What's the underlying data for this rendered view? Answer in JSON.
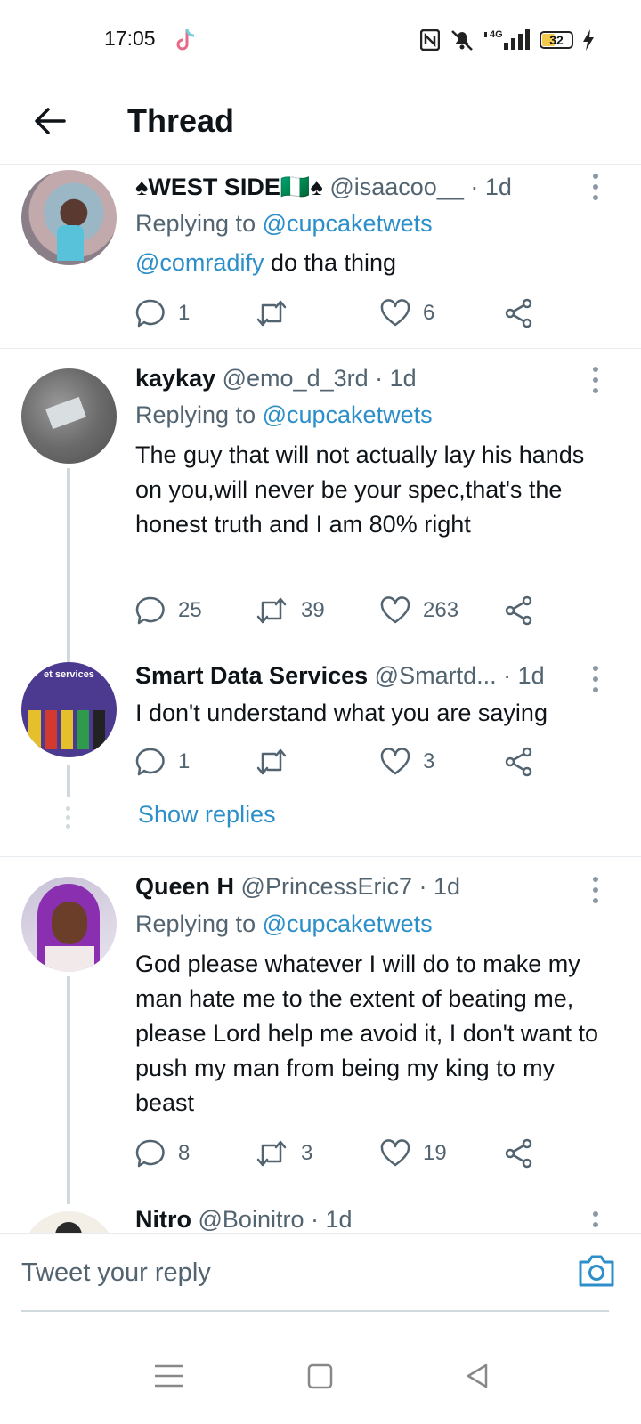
{
  "status_bar": {
    "time": "17:05",
    "network": "4G",
    "battery": "32",
    "icons": [
      "tiktok-icon",
      "nfc-icon",
      "mute-icon",
      "signal-icon",
      "battery-icon",
      "charging-icon"
    ]
  },
  "header": {
    "title": "Thread",
    "back_icon": "arrow-left-icon"
  },
  "tweets": [
    {
      "name": "♠WEST SIDE🇳🇬♠",
      "handle": "@isaacoo__",
      "time": "· 1d",
      "replying_prefix": "Replying to ",
      "replying_to": "@cupcaketwets",
      "mention": "@comradify",
      "text": " do tha thing",
      "replies": "1",
      "retweets": "",
      "likes": "6"
    },
    {
      "name": "kaykay",
      "handle": "@emo_d_3rd",
      "time": "· 1d",
      "replying_prefix": "Replying to ",
      "replying_to": "@cupcaketwets",
      "text": "The guy that will not actually lay his hands on you,will never be your spec,that's the honest truth and I am 80% right",
      "replies": "25",
      "retweets": "39",
      "likes": "263"
    },
    {
      "name": "Smart Data Services",
      "handle": "@Smartd...",
      "time": "· 1d",
      "text": "I don't understand what you are saying",
      "replies": "1",
      "retweets": "",
      "likes": "3",
      "show_replies": "Show replies",
      "avatar_text": "et services"
    },
    {
      "name": "Queen H",
      "handle": "@PrincessEric7",
      "time": "· 1d",
      "replying_prefix": "Replying to ",
      "replying_to": "@cupcaketwets",
      "text": "God please whatever I will do to make my man hate me to the extent of beating me, please Lord help me avoid it, I don't want to push my man from being my king to my beast",
      "replies": "8",
      "retweets": "3",
      "likes": "19"
    },
    {
      "name": "Nitro",
      "handle": "@Boinitro",
      "time": " · 1d"
    }
  ],
  "reply_bar": {
    "placeholder": "Tweet your reply",
    "camera_icon": "camera-icon"
  },
  "nav_bar": {
    "icons": [
      "menu-icon",
      "home-square-icon",
      "back-triangle-icon"
    ]
  },
  "colors": {
    "link": "#2c8fc9",
    "text": "#0f1419",
    "secondary": "#536471",
    "divider": "#e6ecf0"
  }
}
